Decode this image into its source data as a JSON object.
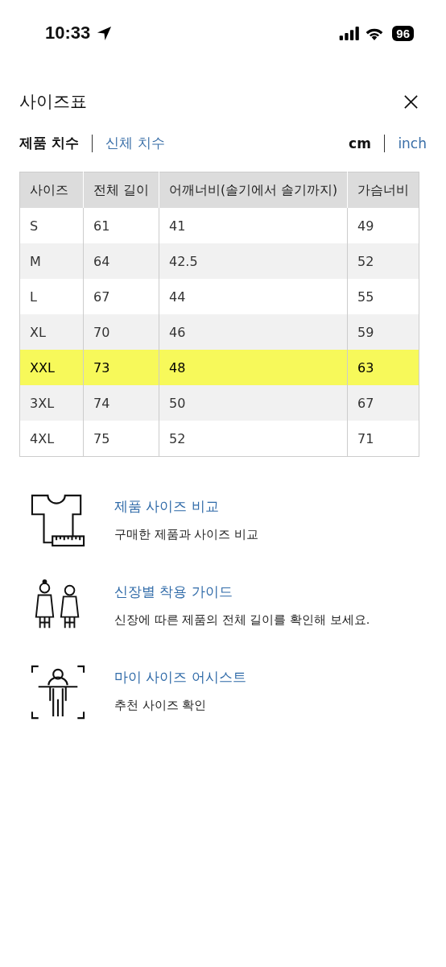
{
  "status_bar": {
    "time": "10:33",
    "battery": "96"
  },
  "title": "사이즈표",
  "tabs": [
    {
      "label": "제품 치수",
      "selected": true
    },
    {
      "label": "신체 치수",
      "selected": false
    }
  ],
  "units": [
    {
      "label": "cm",
      "selected": true
    },
    {
      "label": "inch",
      "selected": false
    }
  ],
  "table": {
    "columns": [
      "사이즈",
      "전체 길이",
      "어깨너비(솔기에서 솔기까지)",
      "가슴너비"
    ],
    "rows": [
      {
        "cells": [
          "S",
          "61",
          "41",
          "49"
        ],
        "highlighted": false
      },
      {
        "cells": [
          "M",
          "64",
          "42.5",
          "52"
        ],
        "highlighted": false
      },
      {
        "cells": [
          "L",
          "67",
          "44",
          "55"
        ],
        "highlighted": false
      },
      {
        "cells": [
          "XL",
          "70",
          "46",
          "59"
        ],
        "highlighted": false
      },
      {
        "cells": [
          "XXL",
          "73",
          "48",
          "63"
        ],
        "highlighted": true
      },
      {
        "cells": [
          "3XL",
          "74",
          "50",
          "67"
        ],
        "highlighted": false
      },
      {
        "cells": [
          "4XL",
          "75",
          "52",
          "71"
        ],
        "highlighted": false
      }
    ]
  },
  "guides": [
    {
      "kind": "shirt",
      "title": "제품 사이즈 비교",
      "description": "구매한 제품과 사이즈 비교"
    },
    {
      "kind": "figures",
      "title": "신장별 착용 가이드",
      "description": "신장에 따른 제품의 전체 길이를 확인해 보세요."
    },
    {
      "kind": "scan",
      "title": "마이 사이즈 어시스트",
      "description": "추천 사이즈 확인"
    }
  ]
}
